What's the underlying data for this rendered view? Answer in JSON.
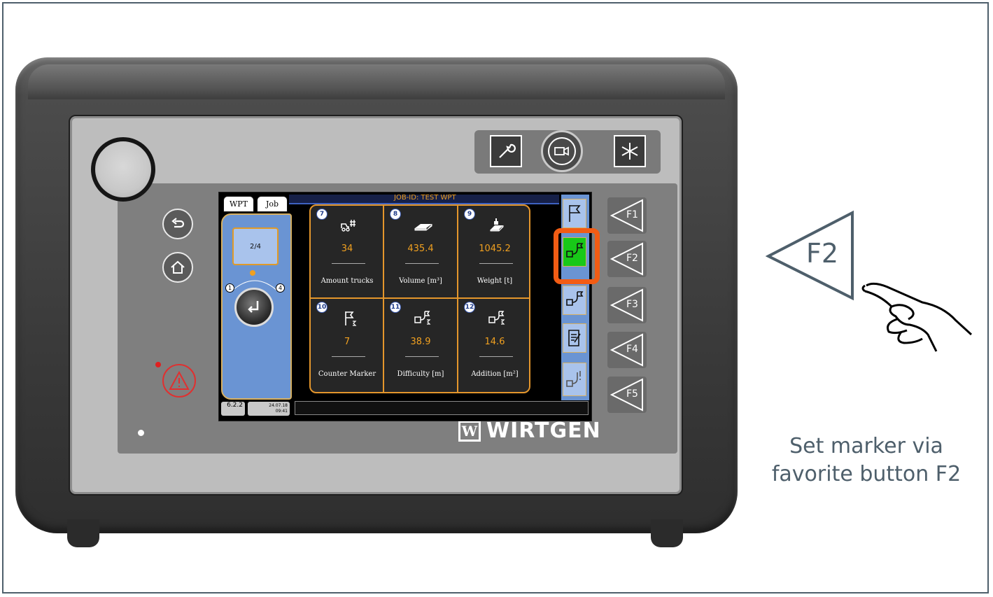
{
  "screen": {
    "tabs": [
      "WPT",
      "Job"
    ],
    "job_id": "JOB-ID: TEST WPT",
    "page_indicator": "2/4",
    "dial_left": "1",
    "dial_right": "4",
    "cells": [
      {
        "num": "7",
        "icon": "truck-count-icon",
        "value": "34",
        "label": "Amount trucks"
      },
      {
        "num": "8",
        "icon": "volume-icon",
        "value": "435.4",
        "label": "Volume [m³]"
      },
      {
        "num": "9",
        "icon": "weight-icon",
        "value": "1045.2",
        "label": "Weight [t]"
      },
      {
        "num": "10",
        "icon": "flag-sum-icon",
        "value": "7",
        "label": "Counter Marker"
      },
      {
        "num": "11",
        "icon": "path-flag-sum-icon",
        "value": "38.9",
        "label": "Difficulty [m]"
      },
      {
        "num": "12",
        "icon": "path-flag-sum-icon",
        "value": "14.6",
        "label": "Addition [m²]"
      }
    ],
    "status": {
      "version": "6.2.2",
      "date": "24.07.18",
      "time": "09:41"
    }
  },
  "device": {
    "brand": "WIRTGEN",
    "brand_mark": "W",
    "function_keys": [
      "F1",
      "F2",
      "F3",
      "F4",
      "F5"
    ],
    "active_key": "F2"
  },
  "annotation": {
    "key": "F2",
    "caption_line1": "Set marker via",
    "caption_line2": "favorite button F2"
  },
  "colors": {
    "highlight": "#f25c14",
    "accent": "#f0a020",
    "active": "#18c818",
    "screen_panel": "#6a94d3"
  }
}
